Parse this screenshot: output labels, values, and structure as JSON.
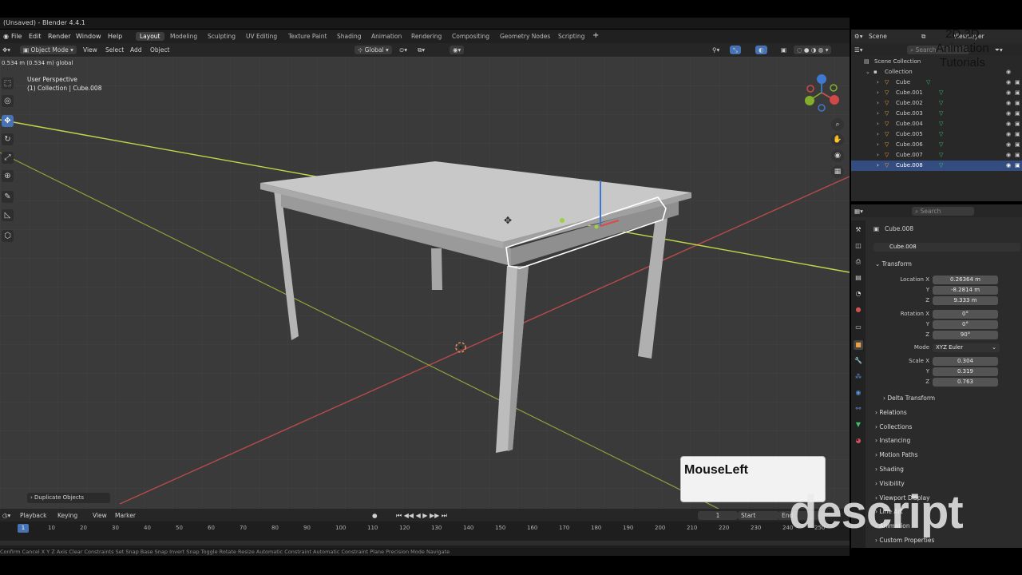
{
  "window_title": "(Unsaved) - Blender 4.4.1",
  "menu": [
    "File",
    "Edit",
    "Render",
    "Window",
    "Help"
  ],
  "workspaces": [
    "Layout",
    "Modeling",
    "Sculpting",
    "UV Editing",
    "Texture Paint",
    "Shading",
    "Animation",
    "Rendering",
    "Compositing",
    "Geometry Nodes",
    "Scripting"
  ],
  "active_workspace": "Layout",
  "viewport_header": {
    "mode": "Object Mode",
    "menus": [
      "View",
      "Select",
      "Add",
      "Object"
    ],
    "orientation": "Global",
    "move_readout": "0.534 m (0.534 m) global"
  },
  "viewport_info": {
    "line1": "User Perspective",
    "line2": "(1) Collection | Cube.008"
  },
  "operator_panel": "Duplicate Objects",
  "outliner": {
    "scene": "Scene",
    "view_layer": "ViewLayer",
    "search_placeholder": "Search",
    "scene_collection": "Scene Collection",
    "collection": "Collection",
    "objects": [
      "Cube",
      "Cube.001",
      "Cube.002",
      "Cube.003",
      "Cube.004",
      "Cube.005",
      "Cube.006",
      "Cube.007",
      "Cube.008"
    ],
    "selected": "Cube.008"
  },
  "properties": {
    "search_placeholder": "Search",
    "object_name": "Cube.008",
    "object_field": "Cube.008",
    "transform_label": "Transform",
    "location_label": "Location X",
    "location": [
      "0.26364 m",
      "-8.2814 m",
      "9.333 m"
    ],
    "rotation_label": "Rotation X",
    "rotation": [
      "0°",
      "0°",
      "90°"
    ],
    "mode_label": "Mode",
    "mode": "XYZ Euler",
    "scale_label": "Scale X",
    "scale": [
      "0.304",
      "0.319",
      "0.763"
    ],
    "axis_y": "Y",
    "axis_z": "Z",
    "collapsed_sections": [
      "Delta Transform",
      "Relations",
      "Collections",
      "Instancing",
      "Motion Paths",
      "Shading",
      "Visibility",
      "Viewport Display",
      "Line Art",
      "Animation",
      "Custom Properties"
    ]
  },
  "timeline": {
    "menus": [
      "Playback",
      "Keying",
      "View",
      "Marker"
    ],
    "current_frame": "1",
    "frame_field": "1",
    "start_label": "Start",
    "end_label": "End",
    "ticks": [
      "10",
      "20",
      "30",
      "40",
      "50",
      "60",
      "70",
      "80",
      "90",
      "100",
      "110",
      "120",
      "130",
      "140",
      "150",
      "160",
      "170",
      "180",
      "190",
      "200",
      "210",
      "220",
      "230",
      "240",
      "250"
    ]
  },
  "statusbar": "Confirm   Cancel   X Y Z Axis   Clear Constraints   Set Snap Base   Snap Invert   Snap Toggle   Rotate   Resize   Automatic Constraint   Automatic Constraint Plane   Precision Mode   Navigate",
  "overlay": {
    "mouse_text": "MouseLeft",
    "logo_text": "descript",
    "watermark_lines": [
      "2D 3D",
      "Animation",
      "Tutorials"
    ]
  },
  "colors": {
    "accent": "#4772b3",
    "x_axis": "#b84a4a",
    "y_axis": "#a9c23a",
    "selected_row": "#334d80",
    "viewport": "#3a3a3a"
  }
}
